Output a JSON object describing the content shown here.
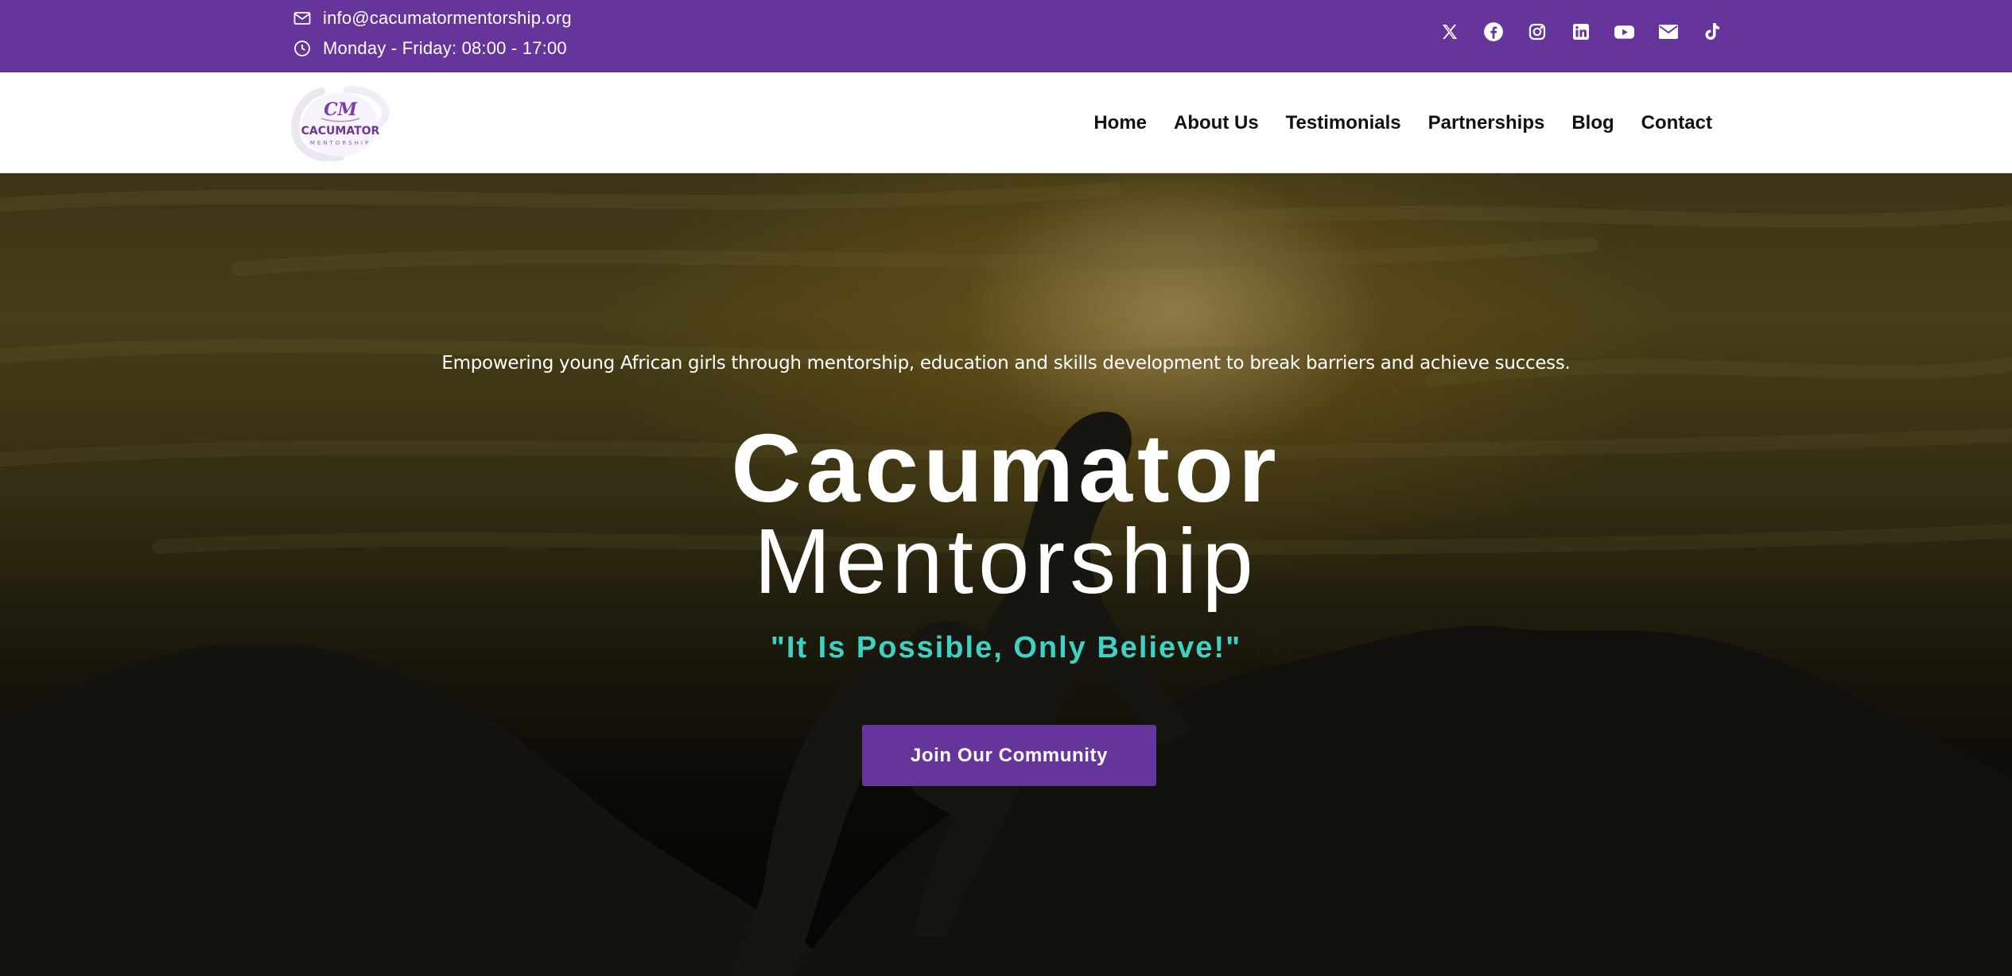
{
  "topbar": {
    "email": "info@cacumatormentorship.org",
    "hours": "Monday - Friday: 08:00 - 17:00",
    "background": "#66359b",
    "social_icons": [
      "x-icon",
      "facebook-icon",
      "instagram-icon",
      "linkedin-icon",
      "youtube-icon",
      "email-icon",
      "tiktok-icon"
    ]
  },
  "header": {
    "logo": {
      "monogram": "CM",
      "name": "CACUMATOR",
      "sub": "MENTORSHIP"
    },
    "nav": [
      "Home",
      "About Us",
      "Testimonials",
      "Partnerships",
      "Blog",
      "Contact"
    ]
  },
  "hero": {
    "tagline": "Empowering young African girls through mentorship, education and skills development to break barriers and achieve success.",
    "title_line1": "Cacumator",
    "title_line2": "Mentorship",
    "motto": "\"It Is Possible, Only Believe!\"",
    "cta": "Join Our Community",
    "accent_color": "#3fd2c3",
    "button_color": "#66359b"
  }
}
